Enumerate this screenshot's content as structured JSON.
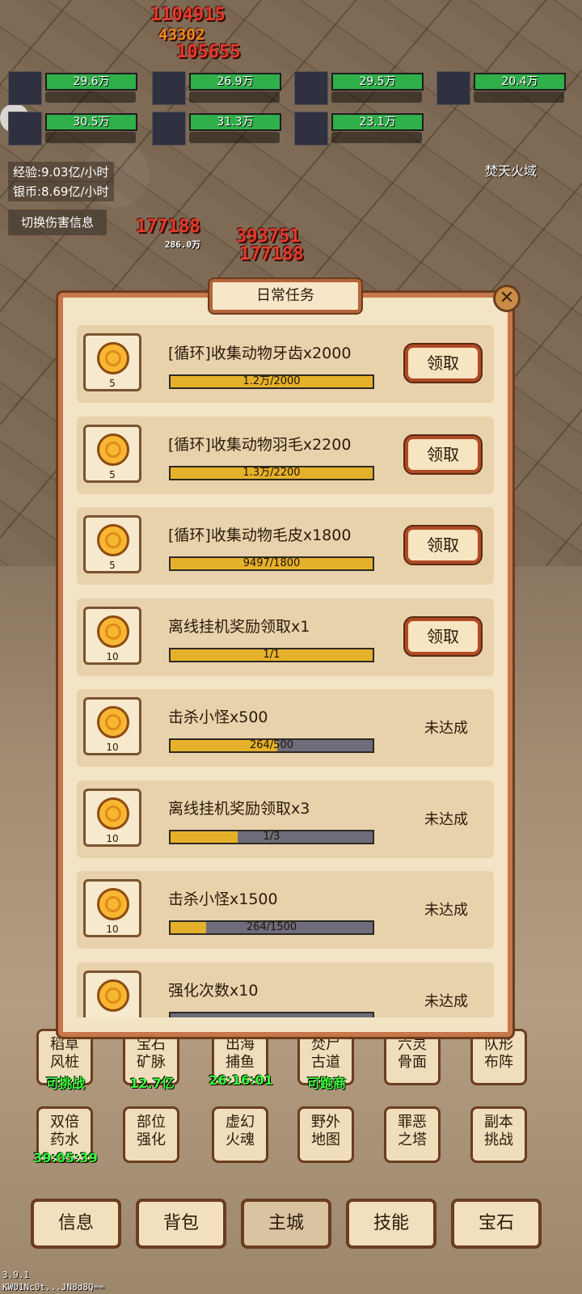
{
  "combat": {
    "damage_numbers": [
      "1104915",
      "43302",
      "105655",
      "177188",
      "286.0万",
      "393751",
      "177188",
      "393751"
    ],
    "heroes": [
      {
        "hp": "29.6万"
      },
      {
        "hp": "26.9万"
      },
      {
        "hp": "29.5万"
      },
      {
        "hp": "20.4万"
      },
      {
        "hp": "30.5万"
      },
      {
        "hp": "31.3万"
      },
      {
        "hp": "23.1万"
      }
    ],
    "exp_rate": "经验:9.03亿/小时",
    "silver_rate": "银币:8.69亿/小时",
    "toggle_damage_label": "切换伤害信息",
    "zone_name": "焚天火域"
  },
  "dialog": {
    "title": "日常任务",
    "close_icon": "close-x-icon",
    "tasks": [
      {
        "name": "[循环]收集动物牙齿x2000",
        "reward_qty": "5",
        "progress_text": "1.2万/2000",
        "progress": 1.0,
        "action": "领取",
        "claimable": true
      },
      {
        "name": "[循环]收集动物羽毛x2200",
        "reward_qty": "5",
        "progress_text": "1.3万/2200",
        "progress": 1.0,
        "action": "领取",
        "claimable": true
      },
      {
        "name": "[循环]收集动物毛皮x1800",
        "reward_qty": "5",
        "progress_text": "9497/1800",
        "progress": 1.0,
        "action": "领取",
        "claimable": true
      },
      {
        "name": "离线挂机奖励领取x1",
        "reward_qty": "10",
        "progress_text": "1/1",
        "progress": 1.0,
        "action": "领取",
        "claimable": true
      },
      {
        "name": "击杀小怪x500",
        "reward_qty": "10",
        "progress_text": "264/500",
        "progress": 0.528,
        "action": "未达成",
        "claimable": false
      },
      {
        "name": "离线挂机奖励领取x3",
        "reward_qty": "10",
        "progress_text": "1/3",
        "progress": 0.333,
        "action": "未达成",
        "claimable": false
      },
      {
        "name": "击杀小怪x1500",
        "reward_qty": "10",
        "progress_text": "264/1500",
        "progress": 0.176,
        "action": "未达成",
        "claimable": false
      },
      {
        "name": "强化次数x10",
        "reward_qty": "",
        "progress_text": "",
        "progress": 0.0,
        "action": "未达成",
        "claimable": false
      }
    ]
  },
  "city_menu": {
    "row1": [
      {
        "label": "稻草\n风桩",
        "sub": "可挑战"
      },
      {
        "label": "宝石\n矿脉",
        "sub": "12.7亿"
      },
      {
        "label": "出海\n捕鱼",
        "sub": "26:16:01"
      },
      {
        "label": "焚尸\n古道",
        "sub": "可跑商"
      },
      {
        "label": "六灵\n骨面",
        "sub": ""
      },
      {
        "label": "队形\n布阵",
        "sub": ""
      }
    ],
    "row2": [
      {
        "label": "双倍\n药水",
        "sub": "39:05:39"
      },
      {
        "label": "部位\n强化",
        "sub": ""
      },
      {
        "label": "虚幻\n火魂",
        "sub": ""
      },
      {
        "label": "野外\n地图",
        "sub": ""
      },
      {
        "label": "罪恶\n之塔",
        "sub": ""
      },
      {
        "label": "副本\n挑战",
        "sub": ""
      }
    ]
  },
  "bottom_nav": [
    "信息",
    "背包",
    "主城",
    "技能",
    "宝石"
  ],
  "active_tab": "主城",
  "version": "3.9.1",
  "device_code": "KW01Nc0t...JN8d8Q=="
}
